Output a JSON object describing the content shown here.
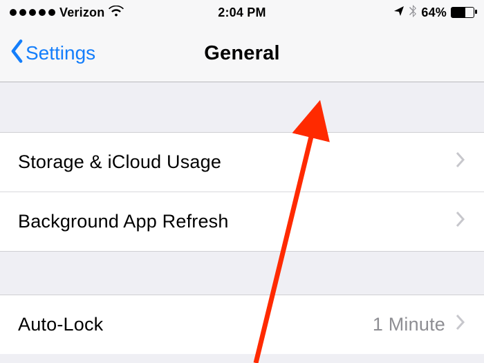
{
  "status": {
    "carrier": "Verizon",
    "time": "2:04 PM",
    "battery_percent": "64%"
  },
  "nav": {
    "back_label": "Settings",
    "title": "General"
  },
  "group1": {
    "items": [
      {
        "label": "Storage & iCloud Usage",
        "value": ""
      },
      {
        "label": "Background App Refresh",
        "value": ""
      }
    ]
  },
  "group2": {
    "items": [
      {
        "label": "Auto-Lock",
        "value": "1 Minute"
      }
    ]
  }
}
